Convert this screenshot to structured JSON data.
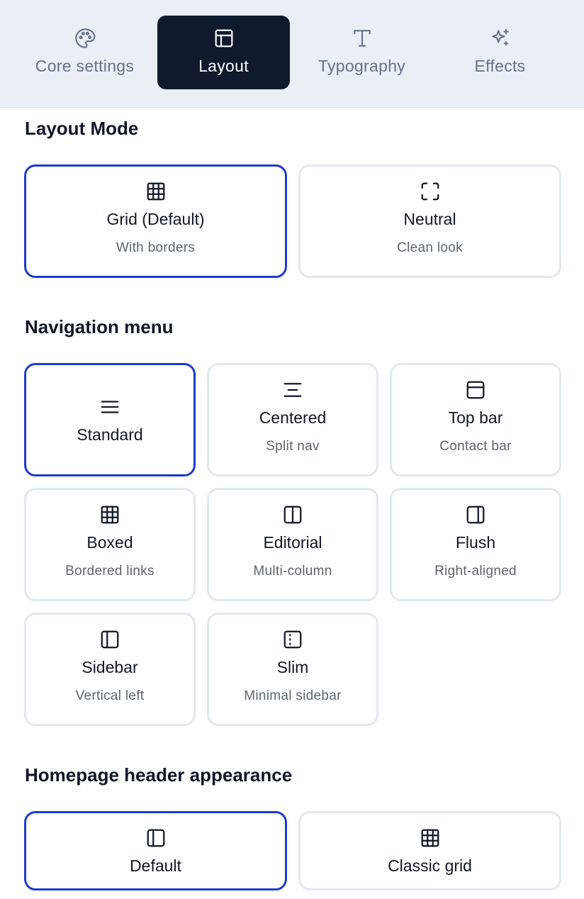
{
  "tabs": [
    {
      "label": "Core settings",
      "icon": "palette-icon"
    },
    {
      "label": "Layout",
      "icon": "layout-icon"
    },
    {
      "label": "Typography",
      "icon": "type-icon"
    },
    {
      "label": "Effects",
      "icon": "sparkles-icon"
    }
  ],
  "active_tab": "Layout",
  "layout_mode": {
    "title": "Layout Mode",
    "options": [
      {
        "title": "Grid (Default)",
        "subtitle": "With borders",
        "icon": "grid-icon",
        "selected": true
      },
      {
        "title": "Neutral",
        "subtitle": "Clean look",
        "icon": "focus-frame-icon",
        "selected": false
      }
    ]
  },
  "navigation_menu": {
    "title": "Navigation menu",
    "options": [
      {
        "title": "Standard",
        "subtitle": "",
        "icon": "menu-icon",
        "selected": true
      },
      {
        "title": "Centered",
        "subtitle": "Split nav",
        "icon": "align-center-icon",
        "selected": false
      },
      {
        "title": "Top bar",
        "subtitle": "Contact bar",
        "icon": "top-bar-icon",
        "selected": false
      },
      {
        "title": "Boxed",
        "subtitle": "Bordered links",
        "icon": "grid-icon",
        "selected": false
      },
      {
        "title": "Editorial",
        "subtitle": "Multi-column",
        "icon": "columns-icon",
        "selected": false
      },
      {
        "title": "Flush",
        "subtitle": "Right-aligned",
        "icon": "panel-right-icon",
        "selected": false
      },
      {
        "title": "Sidebar",
        "subtitle": "Vertical left",
        "icon": "panel-left-icon",
        "selected": false
      },
      {
        "title": "Slim",
        "subtitle": "Minimal sidebar",
        "icon": "panel-left-dashed-icon",
        "selected": false
      }
    ]
  },
  "homepage_header": {
    "title": "Homepage header appearance",
    "options": [
      {
        "title": "Default",
        "subtitle": "",
        "icon": "panel-left-icon",
        "selected": true
      },
      {
        "title": "Classic grid",
        "subtitle": "",
        "icon": "grid-icon",
        "selected": false
      }
    ]
  },
  "colors": {
    "selected_border": "#1d3bcc",
    "active_tab_bg": "#0f1a2e",
    "tabbar_bg": "#eaeef5"
  }
}
